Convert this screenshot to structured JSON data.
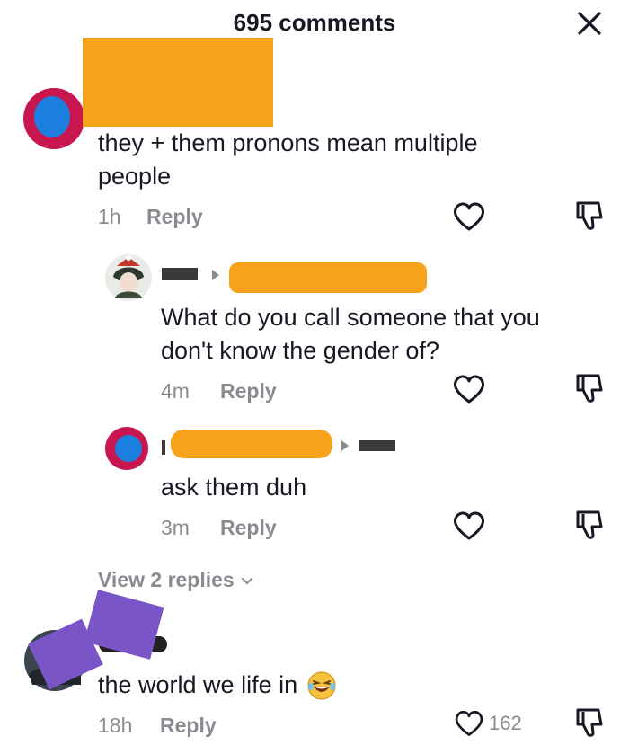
{
  "header": {
    "title": "695 comments"
  },
  "icons": {
    "close": "close-icon",
    "like": "heart-icon",
    "dislike": "thumbs-down-icon",
    "chevron": "chevron-down-icon"
  },
  "comments": [
    {
      "text_line1": "they + them pronons mean multiple",
      "text_line2": "people",
      "time": "1h",
      "reply_label": "Reply"
    },
    {
      "text_line1": "What do you call someone that you",
      "text_line2": "don't know the gender of?",
      "time": "4m",
      "reply_label": "Reply"
    },
    {
      "text_line1": "ask them duh",
      "time": "3m",
      "reply_label": "Reply"
    },
    {
      "text_line1": "the world we life in",
      "emoji": "😂",
      "time": "18h",
      "reply_label": "Reply",
      "like_count": "162"
    }
  ],
  "view_replies_label": "View 2 replies",
  "colors": {
    "accent_orange": "#f7a21b",
    "redact_purple": "#7a55c7",
    "meta_gray": "#8a8b91"
  }
}
